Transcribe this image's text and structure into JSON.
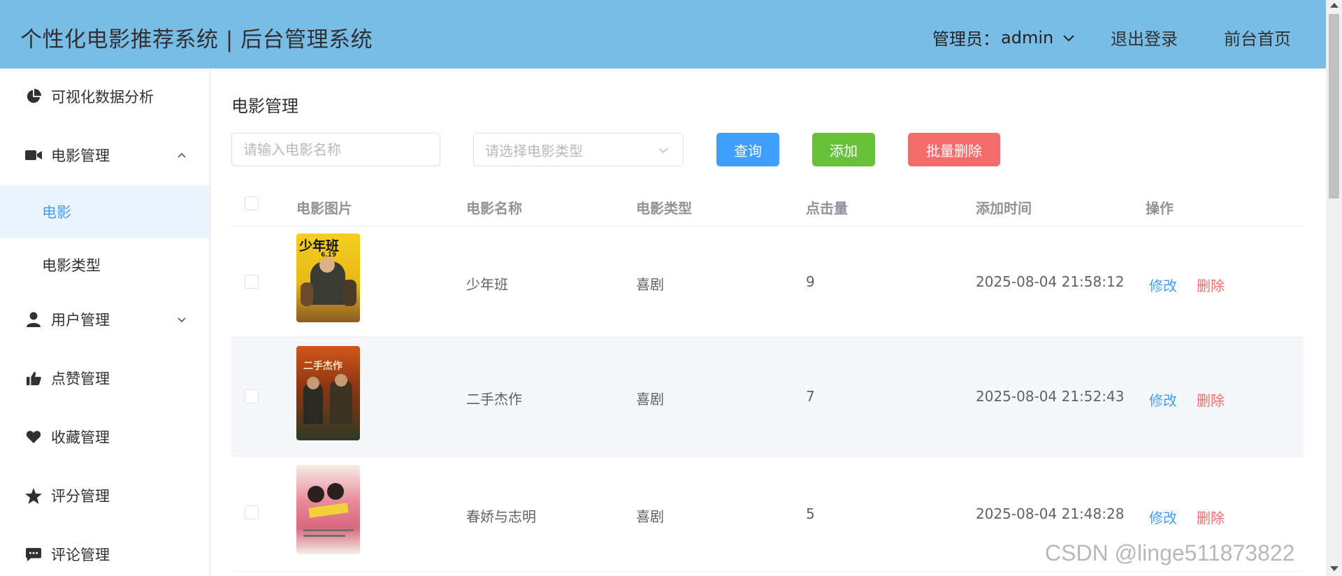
{
  "header": {
    "title": "个性化电影推荐系统 | 后台管理系统",
    "admin_label": "管理员：",
    "admin_name": "admin",
    "logout": "退出登录",
    "front_home": "前台首页",
    "bg_color": "#79bde7"
  },
  "sidebar": {
    "items": [
      {
        "label": "可视化数据分析",
        "icon": "pie-chart-icon"
      },
      {
        "label": "电影管理",
        "icon": "video-camera-icon",
        "expanded": true,
        "arrow": "chevron-up-icon"
      },
      {
        "label": "电影",
        "active": true
      },
      {
        "label": "电影类型"
      },
      {
        "label": "用户管理",
        "icon": "user-icon",
        "expanded": false,
        "arrow": "chevron-down-icon"
      },
      {
        "label": "点赞管理",
        "icon": "thumbs-up-icon"
      },
      {
        "label": "收藏管理",
        "icon": "heart-icon"
      },
      {
        "label": "评分管理",
        "icon": "star-icon"
      },
      {
        "label": "评论管理",
        "icon": "comment-icon"
      }
    ]
  },
  "main": {
    "page_title": "电影管理",
    "search_placeholder": "请输入电影名称",
    "type_select_placeholder": "请选择电影类型",
    "buttons": {
      "query": "查询",
      "add": "添加",
      "bulk_delete": "批量删除"
    },
    "colors": {
      "primary": "#409eff",
      "success": "#67c23a",
      "danger": "#f56c6c"
    },
    "table": {
      "columns": [
        "电影图片",
        "电影名称",
        "电影类型",
        "点击量",
        "添加时间",
        "操作"
      ],
      "rows": [
        {
          "name": "少年班",
          "type": "喜剧",
          "clicks": "9",
          "added": "2025-08-04 21:58:12",
          "edit": "修改",
          "delete": "删除",
          "poster_text": "少年班",
          "poster_date": "6.19"
        },
        {
          "name": "二手杰作",
          "type": "喜剧",
          "clicks": "7",
          "added": "2025-08-04 21:52:43",
          "edit": "修改",
          "delete": "删除",
          "poster_text": "二手杰作"
        },
        {
          "name": "春娇与志明",
          "type": "喜剧",
          "clicks": "5",
          "added": "2025-08-04 21:48:28",
          "edit": "修改",
          "delete": "删除"
        }
      ]
    }
  },
  "watermark": "CSDN @linge511873822"
}
